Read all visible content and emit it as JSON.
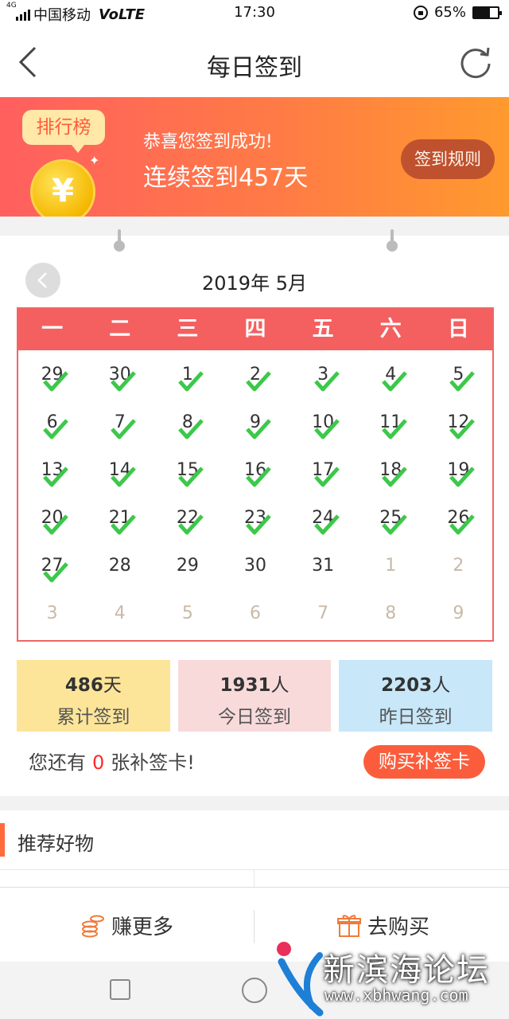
{
  "status_bar": {
    "network": "4G",
    "carrier": "中国移动",
    "volte": "VoLTE",
    "time": "17:30",
    "battery_text": "65%",
    "battery_level": 0.65
  },
  "nav": {
    "title": "每日签到"
  },
  "banner": {
    "rank_tag": "排行榜",
    "coin_symbol": "¥",
    "line1": "恭喜您签到成功!",
    "line2": "连续签到457天",
    "rules_label": "签到规则"
  },
  "calendar": {
    "month_title": "2019年 5月",
    "weekdays": [
      "一",
      "二",
      "三",
      "四",
      "五",
      "六",
      "日"
    ],
    "cells": [
      {
        "d": "29",
        "checked": true,
        "other": false
      },
      {
        "d": "30",
        "checked": true,
        "other": false
      },
      {
        "d": "1",
        "checked": true,
        "other": false
      },
      {
        "d": "2",
        "checked": true,
        "other": false
      },
      {
        "d": "3",
        "checked": true,
        "other": false
      },
      {
        "d": "4",
        "checked": true,
        "other": false
      },
      {
        "d": "5",
        "checked": true,
        "other": false
      },
      {
        "d": "6",
        "checked": true,
        "other": false
      },
      {
        "d": "7",
        "checked": true,
        "other": false
      },
      {
        "d": "8",
        "checked": true,
        "other": false
      },
      {
        "d": "9",
        "checked": true,
        "other": false
      },
      {
        "d": "10",
        "checked": true,
        "other": false
      },
      {
        "d": "11",
        "checked": true,
        "other": false
      },
      {
        "d": "12",
        "checked": true,
        "other": false
      },
      {
        "d": "13",
        "checked": true,
        "other": false
      },
      {
        "d": "14",
        "checked": true,
        "other": false
      },
      {
        "d": "15",
        "checked": true,
        "other": false
      },
      {
        "d": "16",
        "checked": true,
        "other": false
      },
      {
        "d": "17",
        "checked": true,
        "other": false
      },
      {
        "d": "18",
        "checked": true,
        "other": false
      },
      {
        "d": "19",
        "checked": true,
        "other": false
      },
      {
        "d": "20",
        "checked": true,
        "other": false
      },
      {
        "d": "21",
        "checked": true,
        "other": false
      },
      {
        "d": "22",
        "checked": true,
        "other": false
      },
      {
        "d": "23",
        "checked": true,
        "other": false
      },
      {
        "d": "24",
        "checked": true,
        "other": false
      },
      {
        "d": "25",
        "checked": true,
        "other": false
      },
      {
        "d": "26",
        "checked": true,
        "other": false
      },
      {
        "d": "27",
        "checked": true,
        "other": false
      },
      {
        "d": "28",
        "checked": false,
        "other": false
      },
      {
        "d": "29",
        "checked": false,
        "other": false
      },
      {
        "d": "30",
        "checked": false,
        "other": false
      },
      {
        "d": "31",
        "checked": false,
        "other": false
      },
      {
        "d": "1",
        "checked": false,
        "other": true
      },
      {
        "d": "2",
        "checked": false,
        "other": true
      },
      {
        "d": "3",
        "checked": false,
        "other": true
      },
      {
        "d": "4",
        "checked": false,
        "other": true
      },
      {
        "d": "5",
        "checked": false,
        "other": true
      },
      {
        "d": "6",
        "checked": false,
        "other": true
      },
      {
        "d": "7",
        "checked": false,
        "other": true
      },
      {
        "d": "8",
        "checked": false,
        "other": true
      },
      {
        "d": "9",
        "checked": false,
        "other": true
      }
    ]
  },
  "stats": [
    {
      "value": "486",
      "unit": "天",
      "label": "累计签到",
      "color": "#fce599"
    },
    {
      "value": "1931",
      "unit": "人",
      "label": "今日签到",
      "color": "#f8dadb"
    },
    {
      "value": "2203",
      "unit": "人",
      "label": "昨日签到",
      "color": "#c8e7f8"
    }
  ],
  "card_note": {
    "prefix": "您还有",
    "count": "0",
    "suffix": "张补签卡!"
  },
  "buy_button": "购买补签卡",
  "section": {
    "title": "推荐好物"
  },
  "bottom_tabs": {
    "earn": "赚更多",
    "buy": "去购买"
  },
  "watermark": {
    "name": "新滨海论坛",
    "url": "www.xbhwang.com"
  },
  "colors": {
    "accent": "#f46060",
    "orange": "#fb5d3c",
    "check": "#3cc84a"
  }
}
